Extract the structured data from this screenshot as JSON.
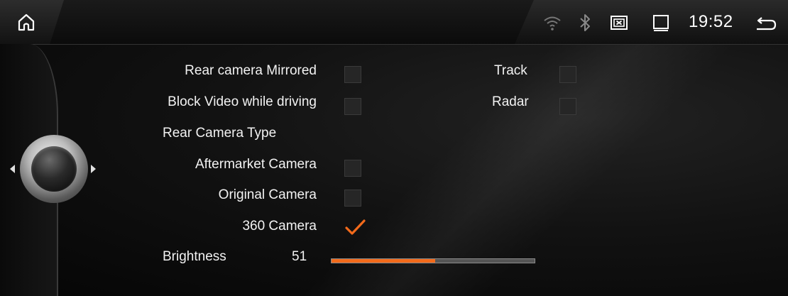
{
  "colors": {
    "accent": "#f26a1b",
    "text": "#f2f2f2",
    "background": "#0a0a0a"
  },
  "status_bar": {
    "time": "19:52",
    "icons": [
      "home-icon",
      "wifi-icon",
      "bluetooth-icon",
      "screen-off-icon",
      "window-icon",
      "back-icon"
    ]
  },
  "settings": {
    "rear_camera_mirrored": {
      "label": "Rear camera Mirrored",
      "checked": false
    },
    "block_video": {
      "label": "Block Video while driving",
      "checked": false
    },
    "track": {
      "label": "Track",
      "checked": false
    },
    "radar": {
      "label": "Radar",
      "checked": false
    },
    "rear_camera_type_heading": "Rear Camera Type",
    "camera_types": [
      {
        "label": "Aftermarket Camera",
        "checked": false
      },
      {
        "label": "Original Camera",
        "checked": false
      },
      {
        "label": "360 Camera",
        "checked": true
      }
    ],
    "brightness": {
      "label": "Brightness",
      "value": "51",
      "fraction": 0.51
    }
  }
}
